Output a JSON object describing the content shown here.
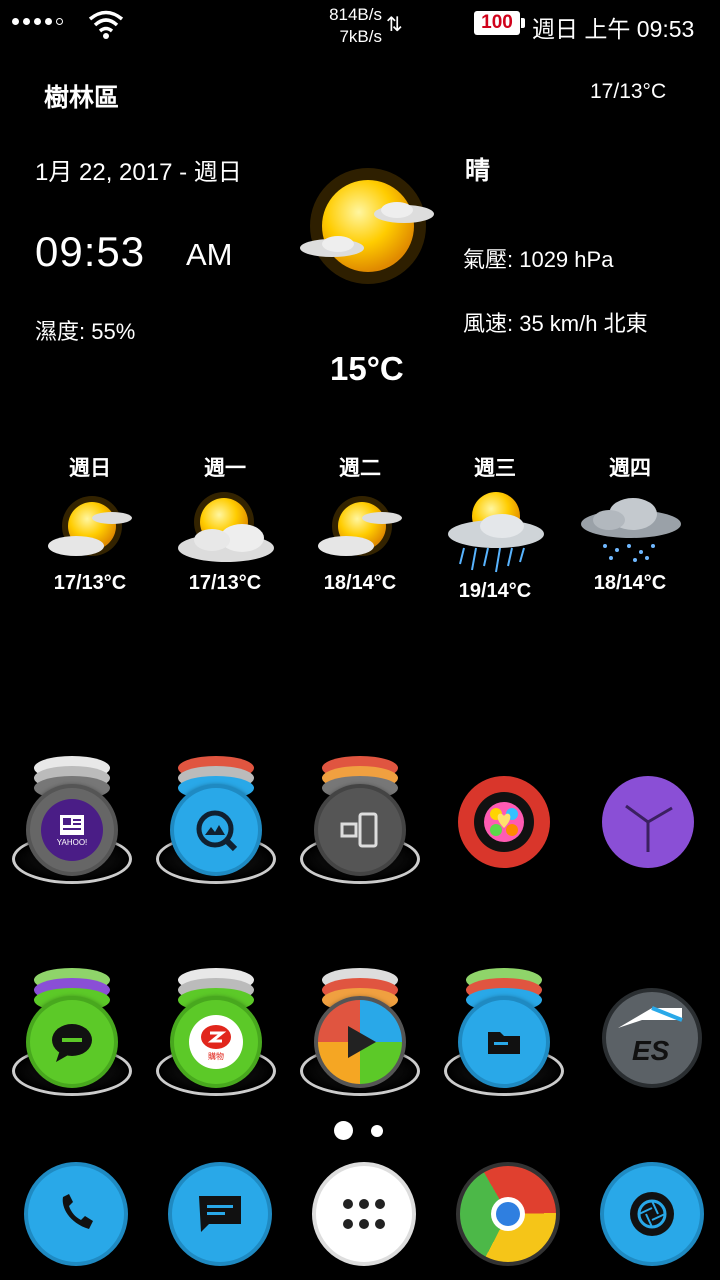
{
  "status_bar": {
    "net_down": "814B/s",
    "net_up": "7kB/s",
    "battery": "100",
    "clock": "週日 上午 09:53"
  },
  "weather": {
    "location": "樹林區",
    "today_range": "17/13°C",
    "date": "1月 22, 2017 - 週日",
    "time": "09:53",
    "ampm": "AM",
    "humidity": "濕度: 55%",
    "condition": "晴",
    "pressure": "氣壓: 1029 hPa",
    "wind": "風速: 35 km/h 北東",
    "temperature": "15°C",
    "forecast": [
      {
        "day": "週日",
        "range": "17/13°C",
        "icon": "partly-cloudy-icon"
      },
      {
        "day": "週一",
        "range": "17/13°C",
        "icon": "cloudy-sun-icon"
      },
      {
        "day": "週二",
        "range": "18/14°C",
        "icon": "partly-cloudy-icon"
      },
      {
        "day": "週三",
        "range": "19/14°C",
        "icon": "sun-rain-icon"
      },
      {
        "day": "週四",
        "range": "18/14°C",
        "icon": "rain-cloud-icon"
      }
    ]
  },
  "apps": {
    "row1": [
      {
        "name": "yahoo-news-folder",
        "text": "YAHOO!"
      },
      {
        "name": "quickpic-folder"
      },
      {
        "name": "tools-folder"
      },
      {
        "name": "candy-game-app"
      },
      {
        "name": "clock-app"
      }
    ],
    "row2": [
      {
        "name": "hangouts-folder"
      },
      {
        "name": "shopping-folder",
        "text": "購物"
      },
      {
        "name": "play-store-folder"
      },
      {
        "name": "file-manager-folder"
      },
      {
        "name": "es-explorer-app",
        "text": "ES"
      }
    ]
  },
  "dock": [
    "phone-app",
    "messages-app",
    "app-drawer",
    "chrome-app",
    "camera-app"
  ],
  "colors": {
    "accent_blue": "#29a8e8",
    "green": "#5cc928",
    "red": "#e03025",
    "purple": "#8a4fd6"
  }
}
